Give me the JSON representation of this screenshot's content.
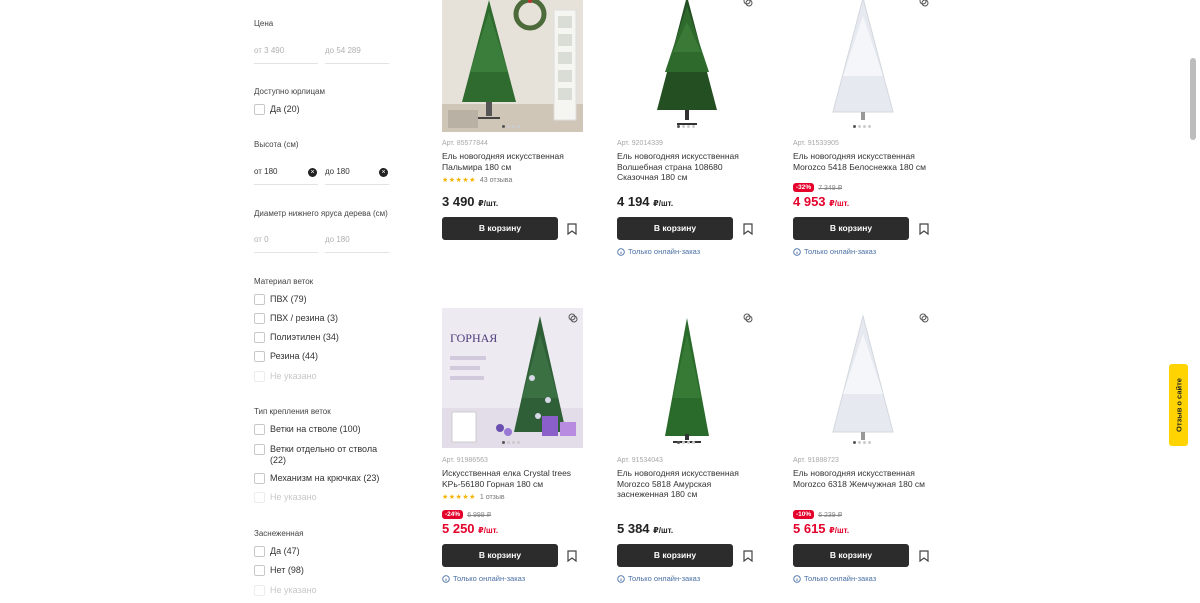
{
  "filters": {
    "price": {
      "title": "Цена",
      "from_placeholder": "от 3 490",
      "to_placeholder": "до 54 289"
    },
    "legal": {
      "title": "Доступно юрлицам",
      "options": [
        {
          "label": "Да (20)"
        }
      ]
    },
    "height": {
      "title": "Высота (см)",
      "from_value": "от 180",
      "to_value": "до 180",
      "clear_symbol": "×"
    },
    "diameter": {
      "title": "Диаметр нижнего яруса дерева (см)",
      "from_placeholder": "от 0",
      "to_placeholder": "до 180"
    },
    "material": {
      "title": "Материал веток",
      "options": [
        {
          "label": "ПВХ (79)"
        },
        {
          "label": "ПВХ / резина (3)"
        },
        {
          "label": "Полиэтилен (34)"
        },
        {
          "label": "Резина (44)"
        },
        {
          "label": "Не указано"
        }
      ]
    },
    "mount": {
      "title": "Тип крепления веток",
      "options": [
        {
          "label": "Ветки на стволе (100)"
        },
        {
          "label": "Ветки отдельно от ствола (22)"
        },
        {
          "label": "Механизм на крючках (23)"
        },
        {
          "label": "Не указано"
        }
      ]
    },
    "snowy": {
      "title": "Заснеженная",
      "options": [
        {
          "label": "Да (47)"
        },
        {
          "label": "Нет (98)"
        },
        {
          "label": "Не указано"
        }
      ]
    }
  },
  "products": [
    {
      "art": "Арт. 85577844",
      "name": "Ель новогодняя искусственная Пальмира 180 см",
      "stars": "★★★★★",
      "reviews": "43 отзыва",
      "price": "3 490",
      "unit": "₽/шт.",
      "buy_label": "В корзину",
      "image": "christmas-tree-photo",
      "tree_color": "#2f6b2f"
    },
    {
      "art": "Арт. 92014339",
      "name": "Ель новогодняя искусственная Волшебная страна 108680 Сказочная 180 см",
      "price": "4 194",
      "unit": "₽/шт.",
      "buy_label": "В корзину",
      "online_label": "Только онлайн-заказ",
      "image": "green-christmas-tree",
      "tree_color": "#2b5e2b"
    },
    {
      "art": "Арт. 91533905",
      "name": "Ель новогодняя искусственная Morozco 5418 Белоснежка 180 см",
      "discount": "-32%",
      "old_price": "7 349 ₽",
      "price": "4 953",
      "unit": "₽/шт.",
      "buy_label": "В корзину",
      "online_label": "Только онлайн-заказ",
      "image": "white-christmas-tree",
      "tree_color": "#e9edf2"
    },
    {
      "art": "Арт. 91986563",
      "name": "Искусственная елка Crystal trees KPь-56180 Горная 180 см",
      "stars": "★★★★★",
      "reviews": "1 отзыв",
      "discount": "-24%",
      "old_price": "6 999 ₽",
      "price": "5 250",
      "unit": "₽/шт.",
      "buy_label": "В корзину",
      "online_label": "Только онлайн-заказ",
      "image": "gornaya-tree-photo",
      "tree_color": "#2f5f36",
      "banner_title": "ГОРНАЯ"
    },
    {
      "art": "Арт. 91534043",
      "name": "Ель новогодняя искусственная Morozco 5818 Амурская заснеженная 180 см",
      "price": "5 384",
      "unit": "₽/шт.",
      "buy_label": "В корзину",
      "online_label": "Только онлайн-заказ",
      "image": "snowy-christmas-tree",
      "tree_color": "#2a6a2a"
    },
    {
      "art": "Арт. 91888723",
      "name": "Ель новогодняя искусственная Morozco 6318 Жемчужная 180 см",
      "discount": "-10%",
      "old_price": "6 239 ₽",
      "price": "5 615",
      "unit": "₽/шт.",
      "buy_label": "В корзину",
      "online_label": "Только онлайн-заказ",
      "image": "white-christmas-tree",
      "tree_color": "#e9edf2"
    }
  ],
  "feedback_tab": "Отзыв о сайте",
  "colors": {
    "accent_red": "#e4002b",
    "button_dark": "#2c2c2c",
    "feedback_yellow": "#ffd400",
    "star_yellow": "#f5b301",
    "link_blue": "#4a6fa5"
  }
}
